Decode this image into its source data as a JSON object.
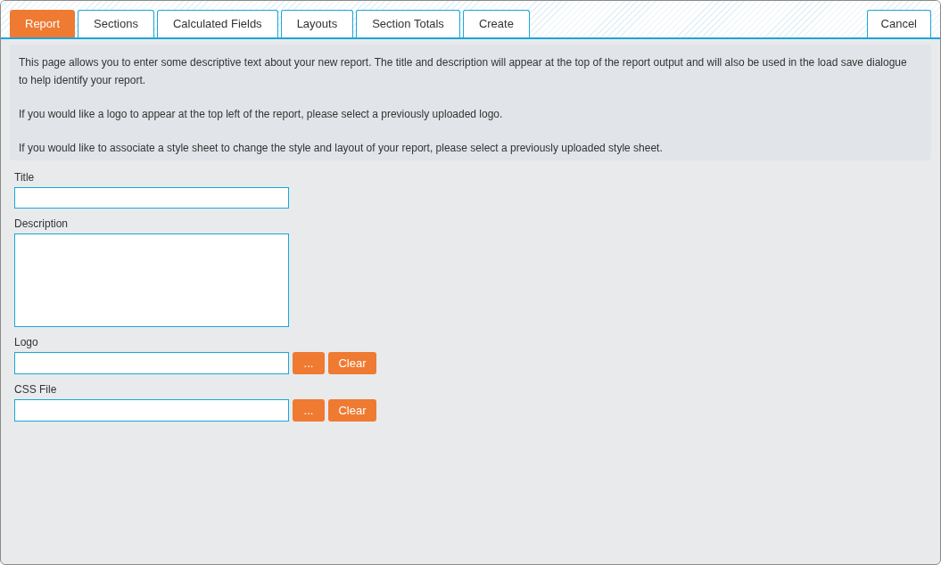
{
  "tabs": [
    {
      "label": "Report",
      "selected": true
    },
    {
      "label": "Sections",
      "selected": false
    },
    {
      "label": "Calculated Fields",
      "selected": false
    },
    {
      "label": "Layouts",
      "selected": false
    },
    {
      "label": "Section Totals",
      "selected": false
    },
    {
      "label": "Create",
      "selected": false
    }
  ],
  "cancel_button": "Cancel",
  "info_paragraphs": [
    "This page allows you to enter some descriptive text about your new report. The title and description will appear at the top of the report output and will also be used in the load save dialogue to help identify your report.",
    "If you would like a logo to appear at the top left of the report, please select a previously uploaded logo.",
    "If you would like to associate a style sheet to change the style and layout of your report, please select a previously uploaded style sheet."
  ],
  "fields": [
    {
      "kind": "text",
      "label": "Title"
    },
    {
      "kind": "textarea",
      "label": "Description"
    },
    {
      "kind": "file",
      "label": "Logo",
      "browse_button": "...",
      "clear_button": "Clear"
    },
    {
      "kind": "file",
      "label": "CSS File",
      "browse_button": "...",
      "clear_button": "Clear"
    }
  ]
}
